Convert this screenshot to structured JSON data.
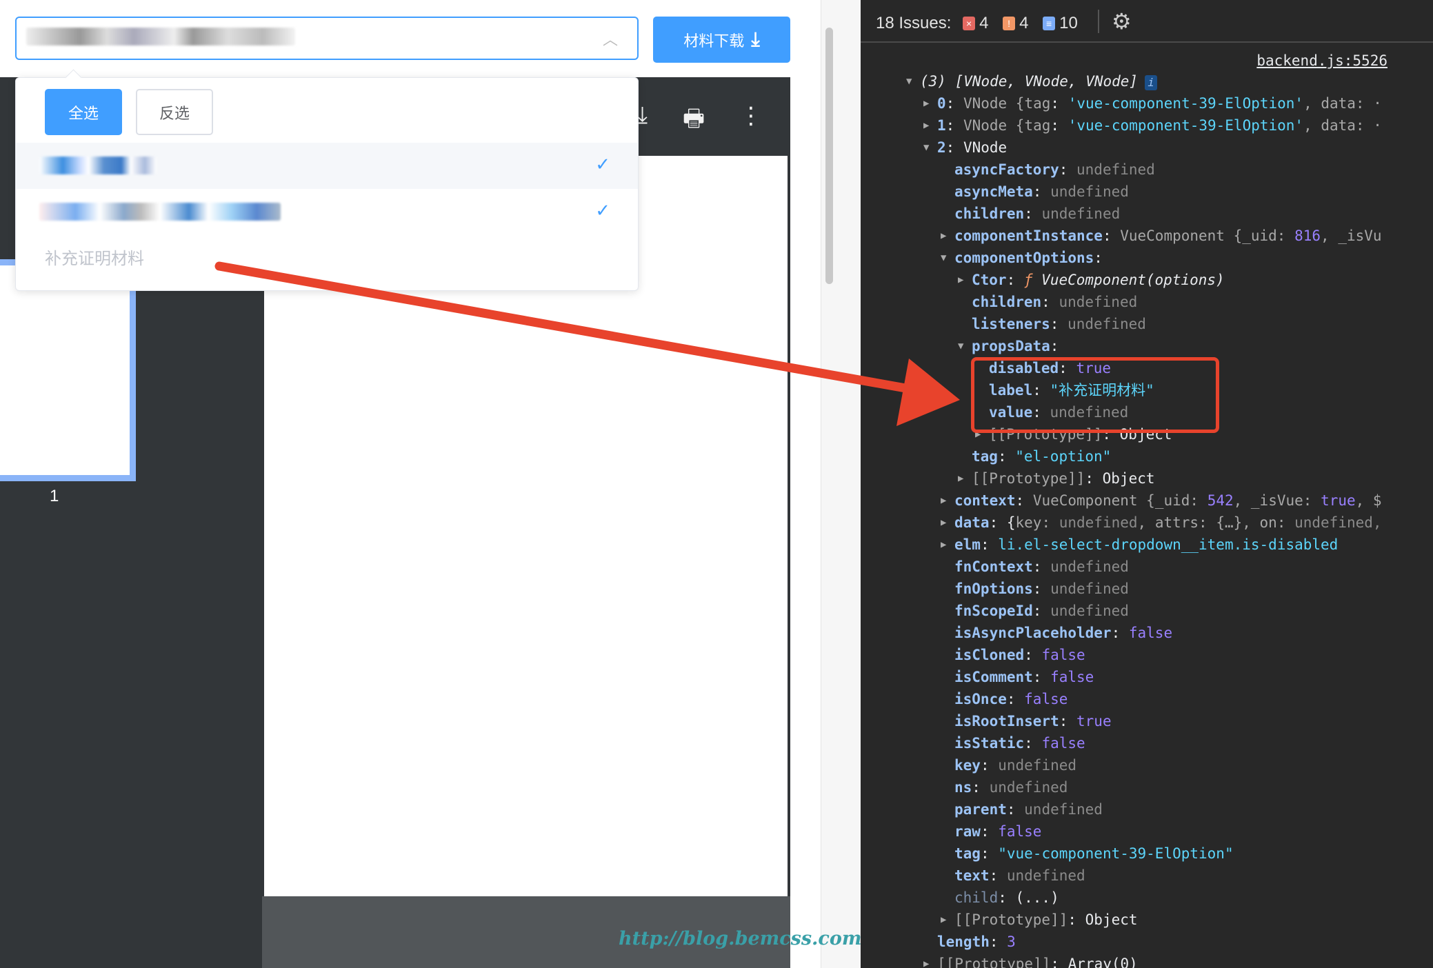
{
  "left": {
    "download_label": "材料下载",
    "select_all": "全选",
    "invert": "反选",
    "disabled_option": "补充证明材料",
    "page_number": "1",
    "check": "✓"
  },
  "devtools": {
    "issues_label": "18 Issues:",
    "errors": "4",
    "warnings": "4",
    "infos": "10",
    "source_link": "backend.js:5526",
    "lines": [
      {
        "l": 0,
        "t": "o",
        "s": [
          [
            "(3) [VNode, VNode, VNode]",
            "p i"
          ]
        ],
        "info": "i"
      },
      {
        "l": 1,
        "t": "c",
        "s": [
          [
            "0",
            "k"
          ],
          [
            ": ",
            "p"
          ],
          [
            "VNode {",
            "g"
          ],
          [
            "tag",
            "g"
          ],
          [
            ": ",
            "p"
          ],
          [
            "'vue-component-39-ElOption'",
            "s"
          ],
          [
            ", data: ·",
            "g"
          ]
        ]
      },
      {
        "l": 1,
        "t": "c",
        "s": [
          [
            "1",
            "k"
          ],
          [
            ": ",
            "p"
          ],
          [
            "VNode {",
            "g"
          ],
          [
            "tag",
            "g"
          ],
          [
            ": ",
            "p"
          ],
          [
            "'vue-component-39-ElOption'",
            "s"
          ],
          [
            ", data: ·",
            "g"
          ]
        ]
      },
      {
        "l": 1,
        "t": "o",
        "s": [
          [
            "2",
            "k"
          ],
          [
            ": VNode",
            "p"
          ]
        ]
      },
      {
        "l": 2,
        "s": [
          [
            "asyncFactory",
            "k"
          ],
          [
            ": ",
            "p"
          ],
          [
            "undefined",
            "u"
          ]
        ]
      },
      {
        "l": 2,
        "s": [
          [
            "asyncMeta",
            "k"
          ],
          [
            ": ",
            "p"
          ],
          [
            "undefined",
            "u"
          ]
        ]
      },
      {
        "l": 2,
        "s": [
          [
            "children",
            "k"
          ],
          [
            ": ",
            "p"
          ],
          [
            "undefined",
            "u"
          ]
        ]
      },
      {
        "l": 2,
        "t": "c",
        "s": [
          [
            "componentInstance",
            "k"
          ],
          [
            ": ",
            "p"
          ],
          [
            "VueComponent {_uid: ",
            "g"
          ],
          [
            "816",
            "n"
          ],
          [
            ", _isVu",
            "g"
          ]
        ]
      },
      {
        "l": 2,
        "t": "o",
        "s": [
          [
            "componentOptions",
            "k"
          ],
          [
            ":",
            "p"
          ]
        ]
      },
      {
        "l": 3,
        "t": "c",
        "s": [
          [
            "Ctor",
            "k"
          ],
          [
            ": ",
            "p"
          ],
          [
            "ƒ ",
            "f"
          ],
          [
            "VueComponent(options)",
            "p i"
          ]
        ]
      },
      {
        "l": 3,
        "s": [
          [
            "children",
            "k"
          ],
          [
            ": ",
            "p"
          ],
          [
            "undefined",
            "u"
          ]
        ]
      },
      {
        "l": 3,
        "s": [
          [
            "listeners",
            "k"
          ],
          [
            ": ",
            "p"
          ],
          [
            "undefined",
            "u"
          ]
        ]
      },
      {
        "l": 3,
        "t": "o",
        "s": [
          [
            "propsData",
            "k"
          ],
          [
            ":",
            "p"
          ]
        ]
      },
      {
        "l": 4,
        "s": [
          [
            "disabled",
            "k"
          ],
          [
            ": ",
            "p"
          ],
          [
            "true",
            "n"
          ]
        ]
      },
      {
        "l": 4,
        "s": [
          [
            "label",
            "k"
          ],
          [
            ": ",
            "p"
          ],
          [
            "\"补充证明材料\"",
            "s"
          ]
        ]
      },
      {
        "l": 4,
        "s": [
          [
            "value",
            "k"
          ],
          [
            ": ",
            "p"
          ],
          [
            "undefined",
            "u"
          ]
        ]
      },
      {
        "l": 4,
        "t": "c",
        "s": [
          [
            "[[Prototype]]",
            "g"
          ],
          [
            ": Object",
            "p"
          ]
        ]
      },
      {
        "l": 3,
        "s": [
          [
            "tag",
            "k"
          ],
          [
            ": ",
            "p"
          ],
          [
            "\"el-option\"",
            "s"
          ]
        ]
      },
      {
        "l": 3,
        "t": "c",
        "s": [
          [
            "[[Prototype]]",
            "g"
          ],
          [
            ": Object",
            "p"
          ]
        ]
      },
      {
        "l": 2,
        "t": "c",
        "s": [
          [
            "context",
            "k"
          ],
          [
            ": ",
            "p"
          ],
          [
            "VueComponent {_uid: ",
            "g"
          ],
          [
            "542",
            "n"
          ],
          [
            ", _isVue: ",
            "g"
          ],
          [
            "true",
            "n"
          ],
          [
            ", $",
            "g"
          ]
        ]
      },
      {
        "l": 2,
        "t": "c",
        "s": [
          [
            "data",
            "k"
          ],
          [
            ": {",
            "p"
          ],
          [
            "key: ",
            "g"
          ],
          [
            "undefined",
            "u"
          ],
          [
            ", attrs: {…}, on: ",
            "g"
          ],
          [
            "undefined,",
            "u"
          ]
        ]
      },
      {
        "l": 2,
        "t": "c",
        "s": [
          [
            "elm",
            "k"
          ],
          [
            ": ",
            "p"
          ],
          [
            "li.el-select-dropdown__item.is-disabled",
            "s"
          ]
        ]
      },
      {
        "l": 2,
        "s": [
          [
            "fnContext",
            "k"
          ],
          [
            ": ",
            "p"
          ],
          [
            "undefined",
            "u"
          ]
        ]
      },
      {
        "l": 2,
        "s": [
          [
            "fnOptions",
            "k"
          ],
          [
            ": ",
            "p"
          ],
          [
            "undefined",
            "u"
          ]
        ]
      },
      {
        "l": 2,
        "s": [
          [
            "fnScopeId",
            "k"
          ],
          [
            ": ",
            "p"
          ],
          [
            "undefined",
            "u"
          ]
        ]
      },
      {
        "l": 2,
        "s": [
          [
            "isAsyncPlaceholder",
            "k"
          ],
          [
            ": ",
            "p"
          ],
          [
            "false",
            "n"
          ]
        ]
      },
      {
        "l": 2,
        "s": [
          [
            "isCloned",
            "k"
          ],
          [
            ": ",
            "p"
          ],
          [
            "false",
            "n"
          ]
        ]
      },
      {
        "l": 2,
        "s": [
          [
            "isComment",
            "k"
          ],
          [
            ": ",
            "p"
          ],
          [
            "false",
            "n"
          ]
        ]
      },
      {
        "l": 2,
        "s": [
          [
            "isOnce",
            "k"
          ],
          [
            ": ",
            "p"
          ],
          [
            "false",
            "n"
          ]
        ]
      },
      {
        "l": 2,
        "s": [
          [
            "isRootInsert",
            "k"
          ],
          [
            ": ",
            "p"
          ],
          [
            "true",
            "n"
          ]
        ]
      },
      {
        "l": 2,
        "s": [
          [
            "isStatic",
            "k"
          ],
          [
            ": ",
            "p"
          ],
          [
            "false",
            "n"
          ]
        ]
      },
      {
        "l": 2,
        "s": [
          [
            "key",
            "k"
          ],
          [
            ": ",
            "p"
          ],
          [
            "undefined",
            "u"
          ]
        ]
      },
      {
        "l": 2,
        "s": [
          [
            "ns",
            "k"
          ],
          [
            ": ",
            "p"
          ],
          [
            "undefined",
            "u"
          ]
        ]
      },
      {
        "l": 2,
        "s": [
          [
            "parent",
            "k"
          ],
          [
            ": ",
            "p"
          ],
          [
            "undefined",
            "u"
          ]
        ]
      },
      {
        "l": 2,
        "s": [
          [
            "raw",
            "k"
          ],
          [
            ": ",
            "p"
          ],
          [
            "false",
            "n"
          ]
        ]
      },
      {
        "l": 2,
        "s": [
          [
            "tag",
            "k"
          ],
          [
            ": ",
            "p"
          ],
          [
            "\"vue-component-39-ElOption\"",
            "s"
          ]
        ]
      },
      {
        "l": 2,
        "s": [
          [
            "text",
            "k"
          ],
          [
            ": ",
            "p"
          ],
          [
            "undefined",
            "u"
          ]
        ]
      },
      {
        "l": 2,
        "s": [
          [
            "child",
            "kd"
          ],
          [
            ": (...)",
            "p"
          ]
        ]
      },
      {
        "l": 2,
        "t": "c",
        "s": [
          [
            "[[Prototype]]",
            "g"
          ],
          [
            ": Object",
            "p"
          ]
        ]
      },
      {
        "l": 1,
        "s": [
          [
            "length",
            "k"
          ],
          [
            ": ",
            "p"
          ],
          [
            "3",
            "n"
          ]
        ]
      },
      {
        "l": 1,
        "t": "c",
        "s": [
          [
            "[[Prototype]]",
            "g"
          ],
          [
            ": Array(0)",
            "p"
          ]
        ]
      }
    ]
  },
  "watermark": "http://blog.bemcss.com",
  "colors": {
    "accent": "#409eff",
    "annotation": "#e8432c",
    "devtools_bg": "#282828"
  }
}
